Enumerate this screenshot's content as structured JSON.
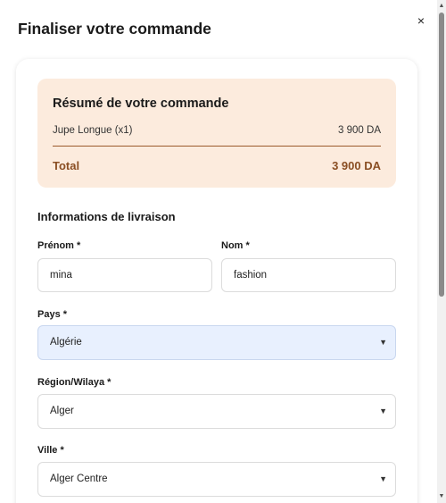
{
  "modal": {
    "title": "Finaliser votre commande",
    "close_glyph": "×"
  },
  "summary": {
    "title": "Résumé de votre commande",
    "items": [
      {
        "name": "Jupe Longue (x1)",
        "price": "3 900 DA"
      }
    ],
    "total_label": "Total",
    "total_value": "3 900 DA"
  },
  "shipping": {
    "section_title": "Informations de livraison",
    "first_name": {
      "label": "Prénom *",
      "value": "mina"
    },
    "last_name": {
      "label": "Nom *",
      "value": "fashion"
    },
    "country": {
      "label": "Pays *",
      "value": "Algérie"
    },
    "region": {
      "label": "Région/Wilaya *",
      "value": "Alger"
    },
    "city": {
      "label": "Ville *",
      "value": "Alger Centre"
    }
  },
  "colors": {
    "summary_bg": "#fcebdd",
    "accent_brown": "#8a4e23",
    "selected_field_bg": "#e8f0fe"
  },
  "icons": {
    "close": "close-icon",
    "dropdown": "chevron-down-icon"
  }
}
